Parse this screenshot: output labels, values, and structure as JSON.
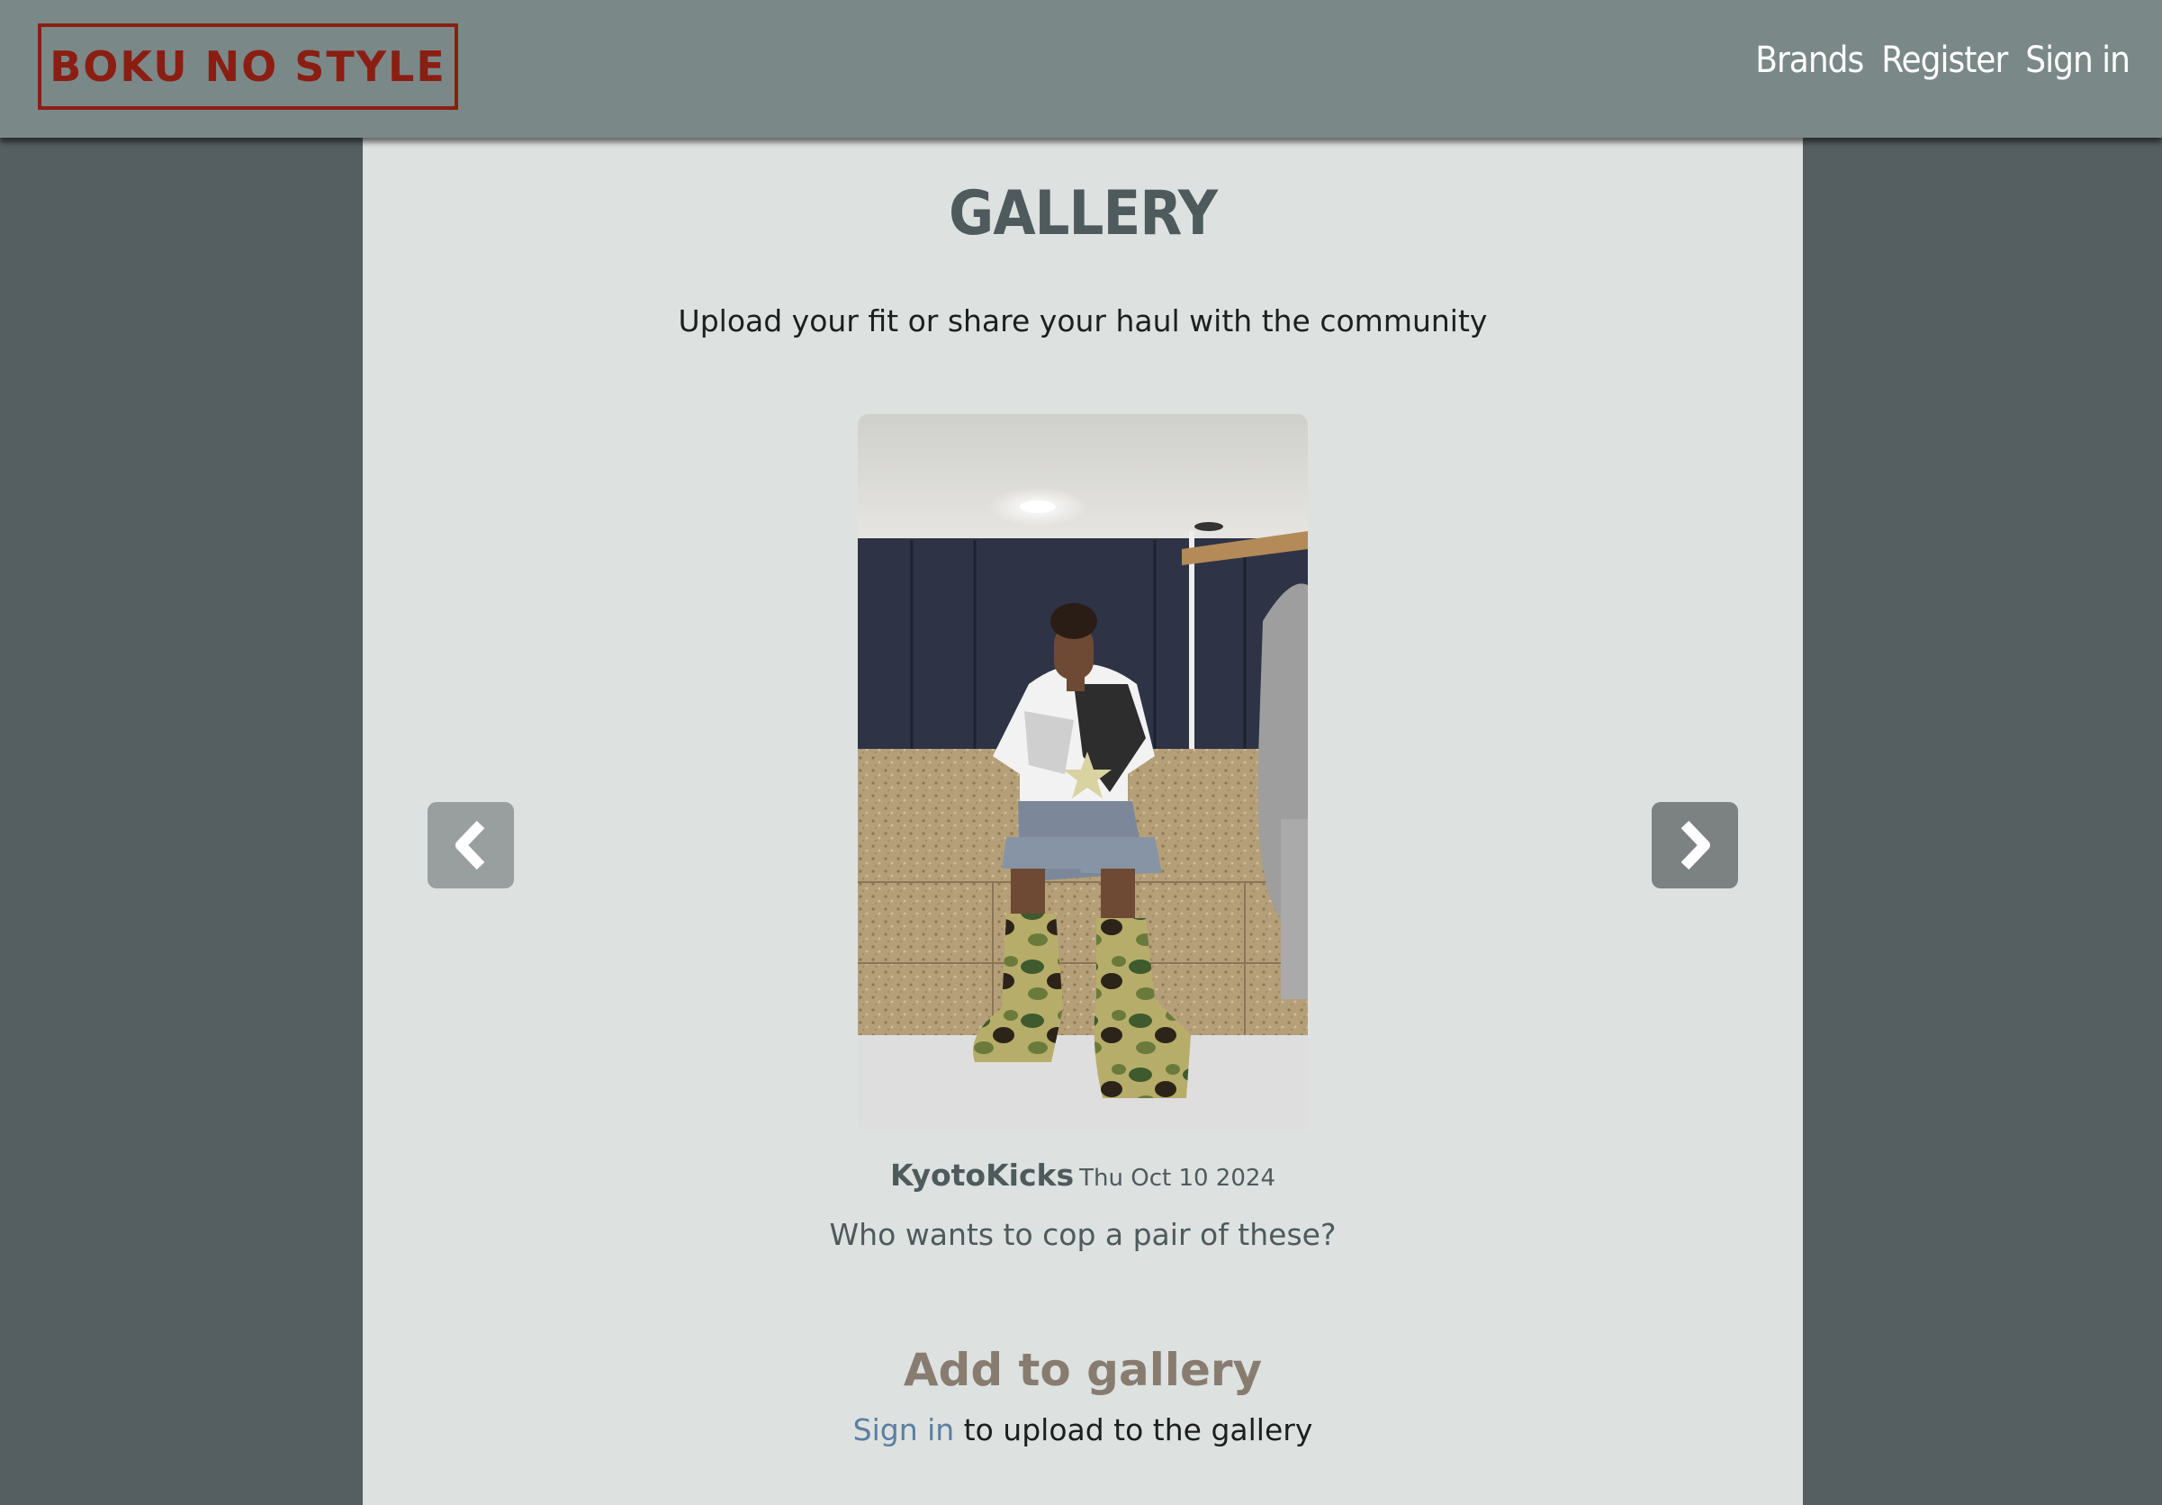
{
  "header": {
    "brand": "BOKU NO STYLE",
    "nav": [
      {
        "label": "Brands"
      },
      {
        "label": "Register"
      },
      {
        "label": "Sign in"
      }
    ]
  },
  "main": {
    "title": "GALLERY",
    "subtitle": "Upload your fit or share your haul with the community",
    "carousel": {
      "prev_icon": "chevron-left-icon",
      "next_icon": "chevron-right-icon",
      "current_post": {
        "username": "KyotoKicks",
        "date": "Thu Oct 10 2024",
        "caption": "Who wants to cop a pair of these?"
      }
    },
    "add_section": {
      "heading": "Add to gallery",
      "signin_link": "Sign in",
      "signin_text": " to upload to the gallery"
    }
  },
  "colors": {
    "navbar": "#7b8888",
    "brand_red": "#8b1e12",
    "page_bg": "#555e60",
    "content_bg": "#dde1e0",
    "link_blue": "#5a7fa0",
    "heading_tan": "#877c6f"
  }
}
